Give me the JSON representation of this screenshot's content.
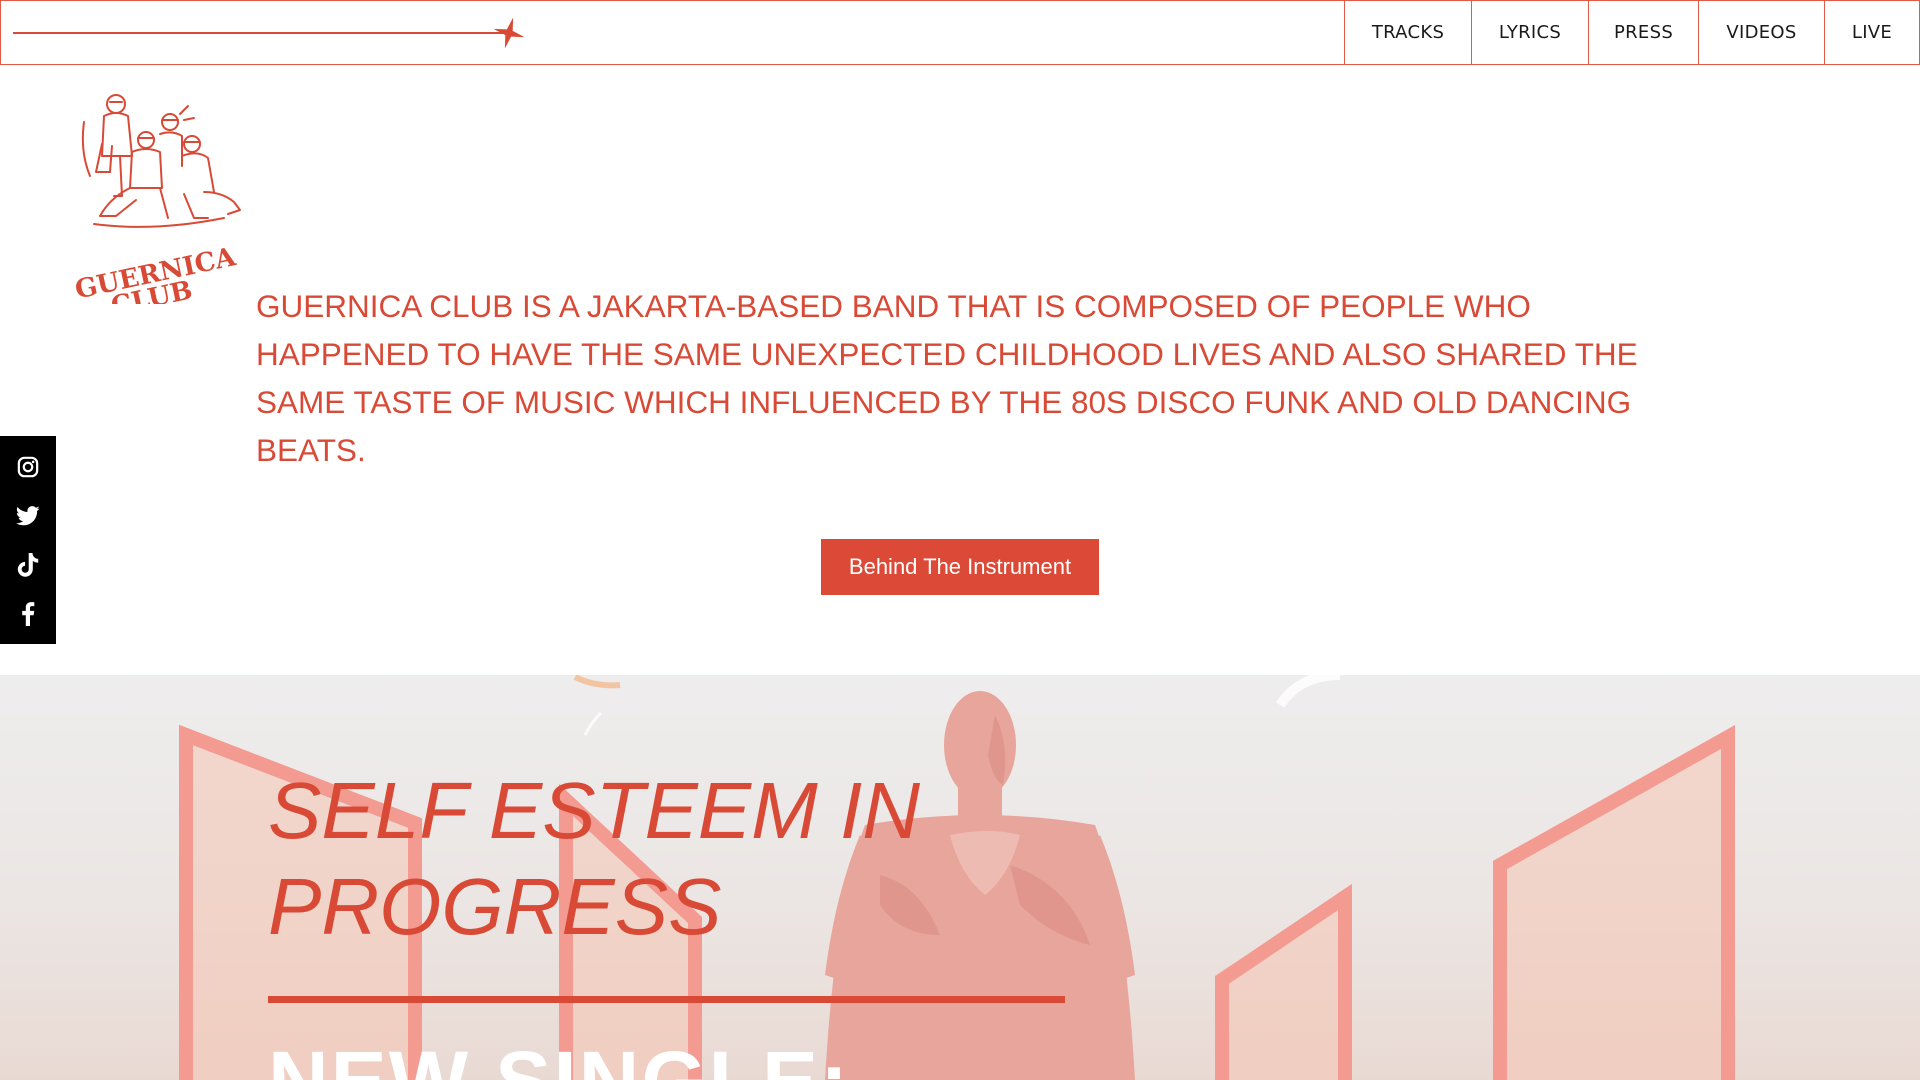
{
  "nav": {
    "items": [
      {
        "label": "TRACKS"
      },
      {
        "label": "LYRICS"
      },
      {
        "label": "PRESS"
      },
      {
        "label": "VIDEOS"
      },
      {
        "label": "LIVE"
      }
    ]
  },
  "logo": {
    "text_line1": "GUERNICA",
    "text_line2": "CLUB"
  },
  "intro": {
    "text": "Guernica Club is a Jakarta-based band that is composed of people who happened to have the same unexpected childhood lives and also shared the same taste of music which influenced by the 80s disco funk and old dancing beats."
  },
  "cta": {
    "label": "Behind The Instrument"
  },
  "social": {
    "icons": [
      "instagram-icon",
      "twitter-icon",
      "tiktok-icon",
      "facebook-icon"
    ]
  },
  "hero": {
    "title": "SELF ESTEEM IN PROGRESS",
    "subtitle": "NEW SINGLE:"
  },
  "colors": {
    "accent": "#d94a36",
    "button": "#dc4a37",
    "social_bg": "#000000",
    "hero_pink": "#f3a49a"
  }
}
